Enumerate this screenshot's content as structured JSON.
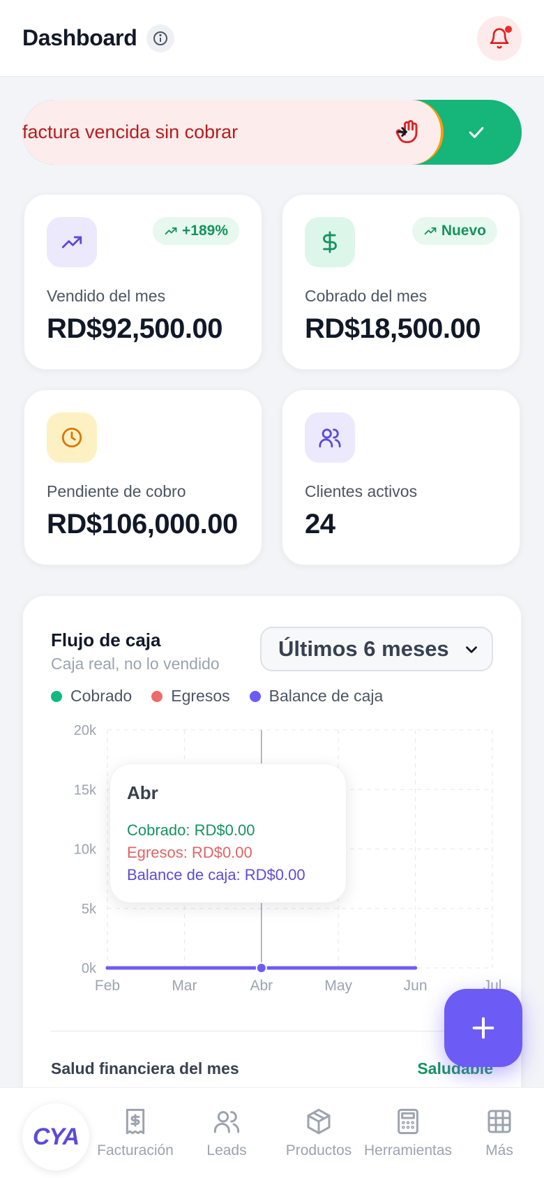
{
  "header": {
    "title": "Dashboard",
    "info_icon": "info-icon",
    "bell_icon": "bell-icon"
  },
  "alert": {
    "text": "factura vencida sin cobrar",
    "hand_icon": "hand-swipe-icon",
    "action_icon": "check-icon"
  },
  "stats": [
    {
      "label": "Vendido del mes",
      "value": "RD$92,500.00",
      "badge": "+189%",
      "icon": "trending-up-icon"
    },
    {
      "label": "Cobrado del mes",
      "value": "RD$18,500.00",
      "badge": "Nuevo",
      "icon": "dollar-icon"
    },
    {
      "label": "Pendiente de cobro",
      "value": "RD$106,000.00",
      "icon": "clock-icon"
    },
    {
      "label": "Clientes activos",
      "value": "24",
      "icon": "users-icon"
    }
  ],
  "cashflow": {
    "title": "Flujo de caja",
    "subtitle": "Caja real, no lo vendido",
    "range_selected": "Últimos 6 meses",
    "tooltip": {
      "month": "Abr",
      "cobrado": "Cobrado: RD$0.00",
      "egresos": "Egresos: RD$0.00",
      "balance": "Balance de caja: RD$0.00"
    },
    "health_label": "Salud financiera del mes",
    "health_value": "Saludable"
  },
  "chart_data": {
    "type": "line",
    "categories": [
      "Feb",
      "Mar",
      "Abr",
      "May",
      "Jun",
      "Jul"
    ],
    "y_ticks": [
      "20k",
      "15k",
      "10k",
      "5k",
      "0k"
    ],
    "ylim": [
      0,
      20000
    ],
    "grid": true,
    "legend_position": "top-left",
    "series": [
      {
        "name": "Cobrado",
        "color": "#10b981",
        "values": [
          0,
          0,
          0,
          0,
          0,
          null
        ]
      },
      {
        "name": "Egresos",
        "color": "#ef6a6a",
        "values": [
          0,
          0,
          0,
          0,
          0,
          null
        ]
      },
      {
        "name": "Balance de caja",
        "color": "#6d5bf6",
        "values": [
          0,
          0,
          0,
          0,
          0,
          null
        ]
      }
    ],
    "highlight_category": "Abr"
  },
  "nav": {
    "logo": "CYA",
    "items": [
      {
        "label": "Facturación",
        "icon": "receipt-icon"
      },
      {
        "label": "Leads",
        "icon": "users-icon"
      },
      {
        "label": "Productos",
        "icon": "box-icon"
      },
      {
        "label": "Herramientas",
        "icon": "calculator-icon"
      },
      {
        "label": "Más",
        "icon": "grid-icon"
      }
    ]
  },
  "colors": {
    "accent": "#6d5bf6",
    "success": "#15935f",
    "danger": "#b91c1c"
  }
}
